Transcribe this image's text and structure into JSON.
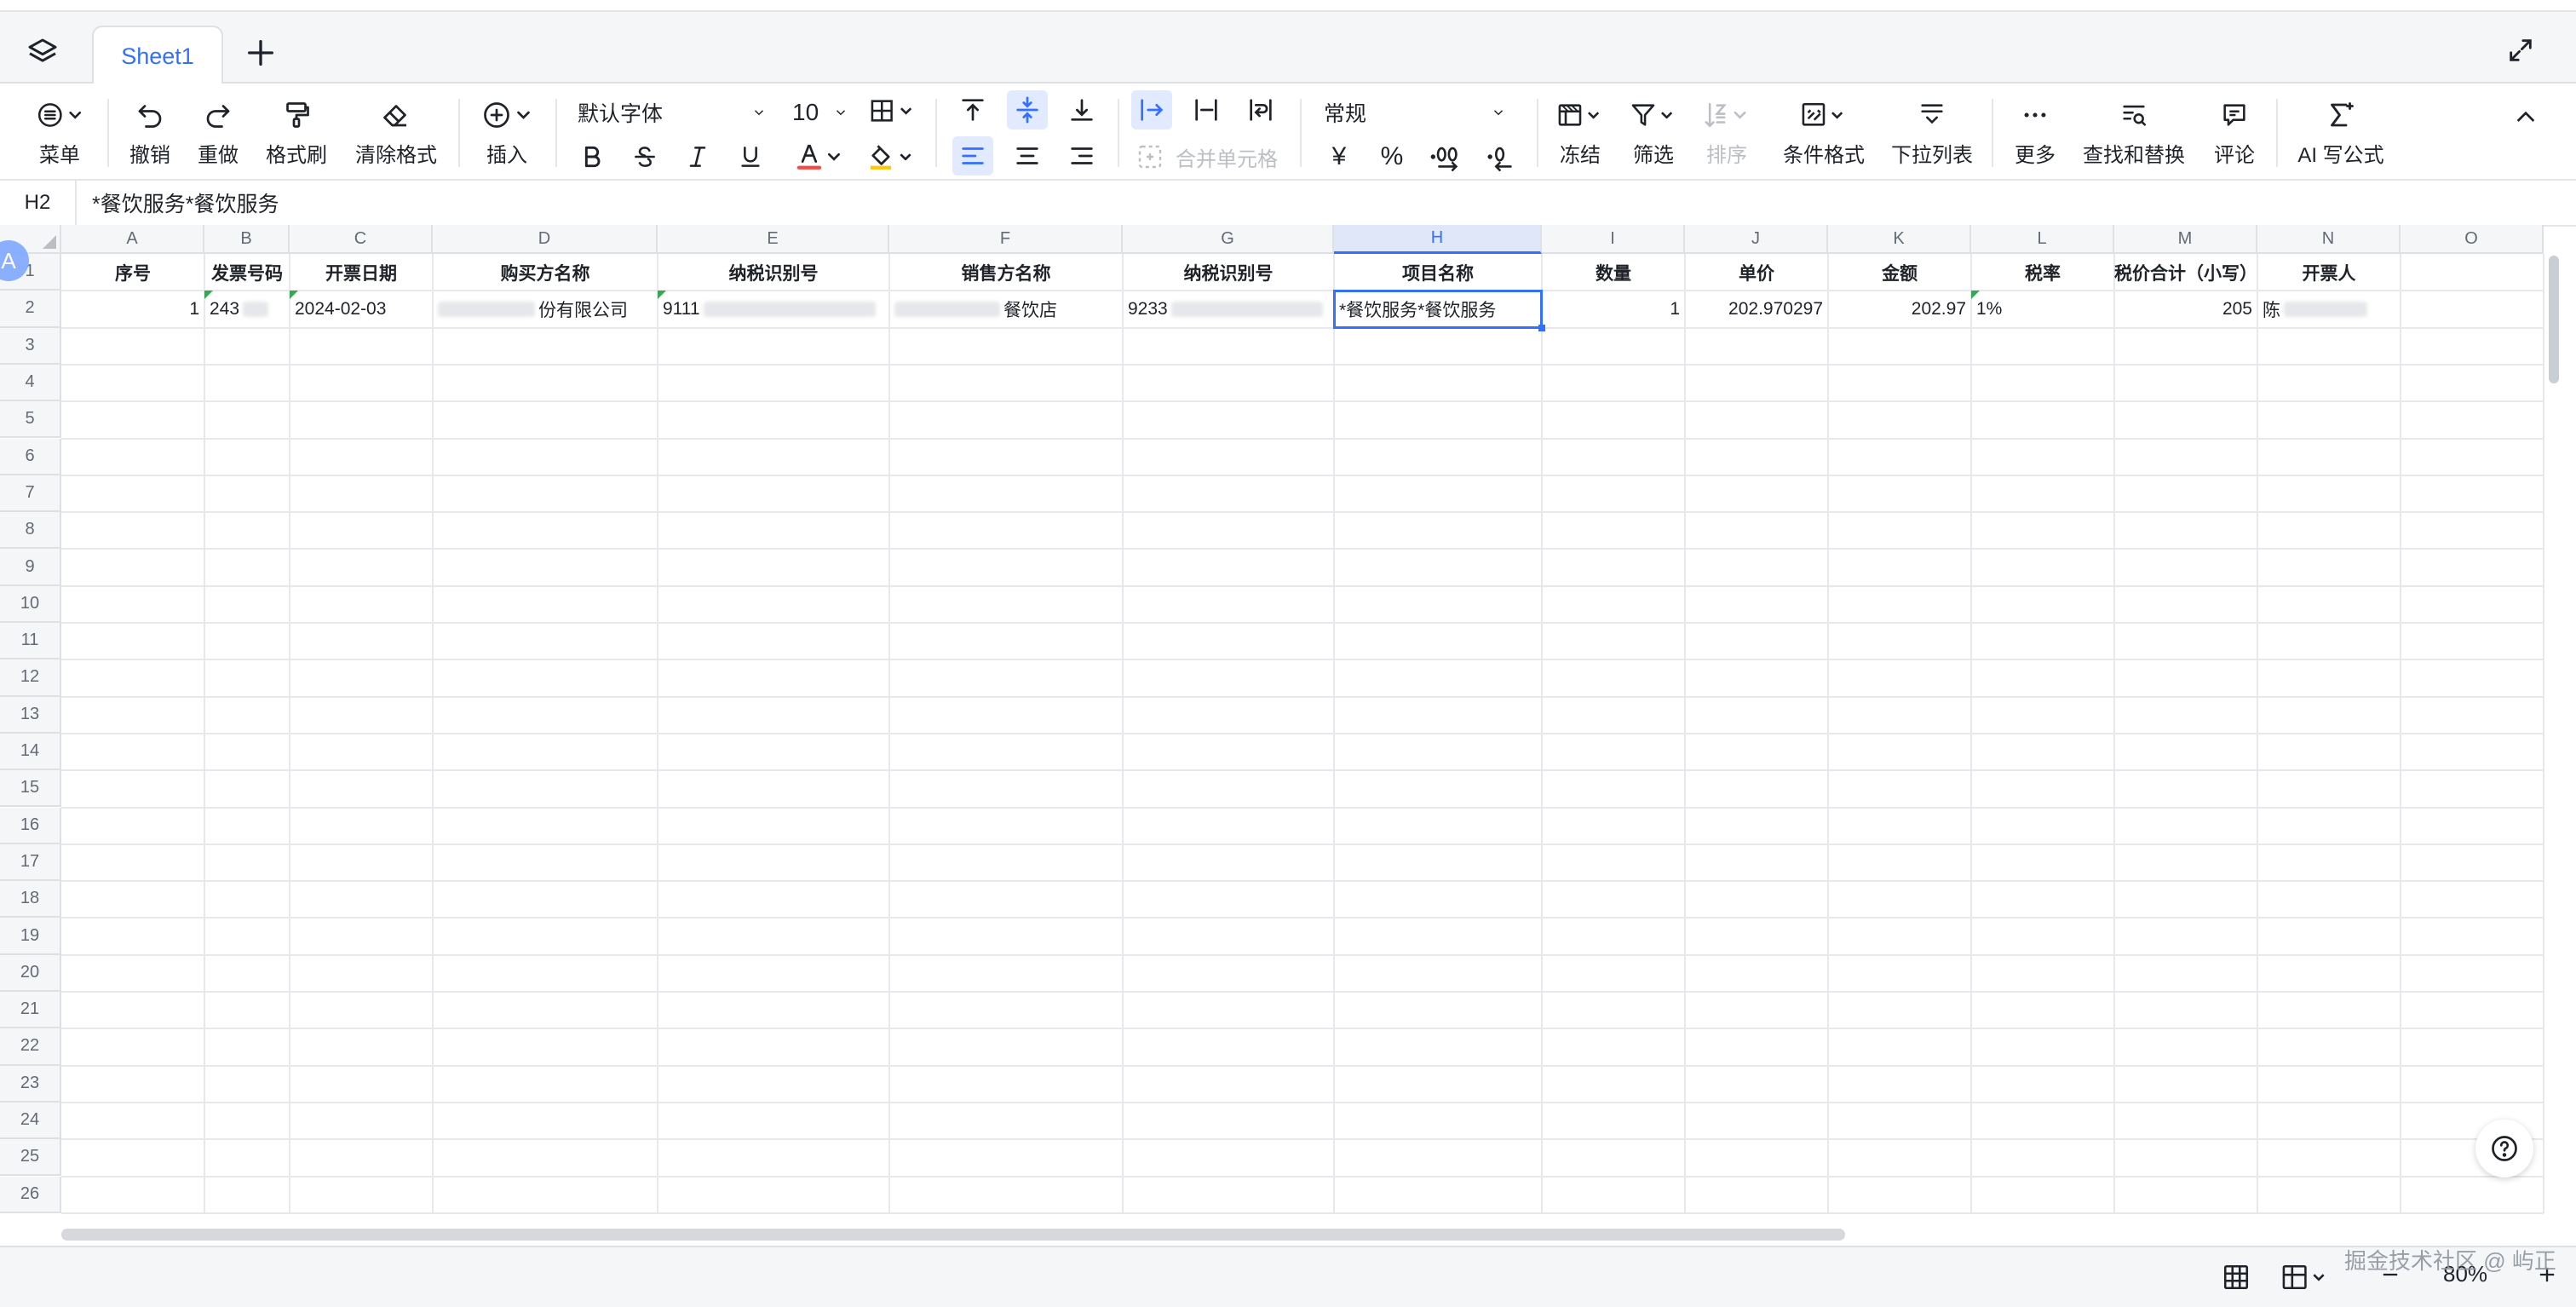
{
  "tabs": {
    "sheet_name": "Sheet1"
  },
  "toolbar": {
    "menu": "菜单",
    "undo": "撤销",
    "redo": "重做",
    "format_painter": "格式刷",
    "clear_format": "清除格式",
    "insert": "插入",
    "font_family": "默认字体",
    "font_size": "10",
    "merge_cells": "合并单元格",
    "number_format": "常规",
    "currency_symbol": "¥",
    "percent_symbol": "%",
    "freeze": "冻结",
    "filter": "筛选",
    "sort": "排序",
    "conditional_format": "条件格式",
    "dropdown_list": "下拉列表",
    "more": "更多",
    "find_replace": "查找和替换",
    "comment": "评论",
    "ai_formula": "AI 写公式"
  },
  "formula_bar": {
    "cell_ref": "H2",
    "value": "*餐饮服务*餐饮服务"
  },
  "columns": [
    "A",
    "B",
    "C",
    "D",
    "E",
    "F",
    "G",
    "H",
    "I",
    "J",
    "K",
    "L",
    "M",
    "N",
    "O"
  ],
  "rows": [
    "1",
    "2",
    "3",
    "4",
    "5",
    "6",
    "7",
    "8",
    "9",
    "10",
    "11",
    "12",
    "13",
    "14",
    "15",
    "16",
    "17",
    "18",
    "19",
    "20",
    "21",
    "22",
    "23",
    "24",
    "25",
    "26"
  ],
  "header_row": {
    "A": "序号",
    "B": "发票号码",
    "C": "开票日期",
    "D": "购买方名称",
    "E": "纳税识别号",
    "F": "销售方名称",
    "G": "纳税识别号",
    "H": "项目名称",
    "I": "数量",
    "J": "单价",
    "K": "金额",
    "L": "税率",
    "M": "税价合计（小写）",
    "N": "开票人"
  },
  "data_row": {
    "A": "1",
    "B": "243",
    "C": "2024-02-03",
    "D": "份有限公司",
    "E": "9111",
    "F": "餐饮店",
    "G": "9233",
    "H": "*餐饮服务*餐饮服务",
    "I": "1",
    "J": "202.970297",
    "K": "202.97",
    "L": "1%",
    "M": "205",
    "N": "陈"
  },
  "avatar_initial": "A",
  "status_bar": {
    "zoom": "80%"
  },
  "watermark": "掘金技术社区 @ 屿正",
  "colors": {
    "accent": "#3370ff",
    "grid_line": "#e6e8eb",
    "header_bg": "#f5f6f7",
    "font_red": "#f54a45",
    "fill_yellow": "#ffc60a"
  }
}
